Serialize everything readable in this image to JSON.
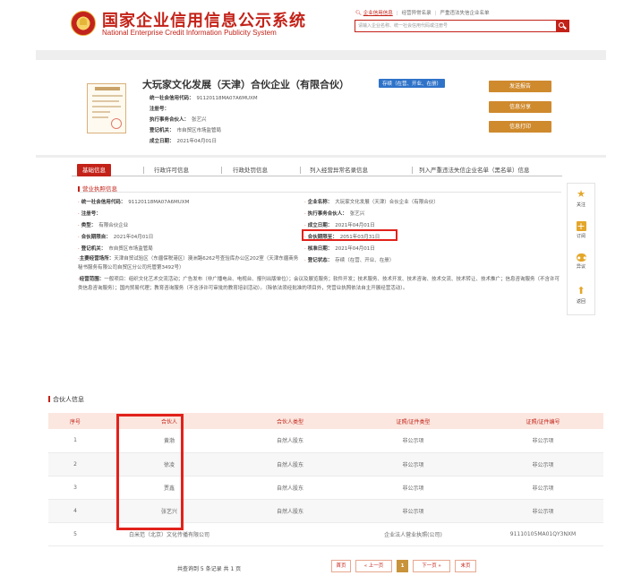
{
  "header": {
    "title": "国家企业信用信息公示系统",
    "subtitle": "National Enterprise Credit Information Publicity System",
    "search_links": [
      "企业信用信息",
      "经营异常名录",
      "严重违法失信企业名单"
    ],
    "search_placeholder": "请输入企业名称、统一社会信用代码或注册号"
  },
  "company": {
    "name": "大玩家文化发展（天津）合伙企业（有限合伙）",
    "status": "存续（在营、开业、在册）",
    "rows": [
      {
        "k": "统一社会信用代码：",
        "v": "91120118MA07A6MUXM"
      },
      {
        "k": "注册号：",
        "v": ""
      },
      {
        "k": "执行事务合伙人：",
        "v": "张艺兴"
      },
      {
        "k": "登记机关：",
        "v": "市自贸区市场监管局"
      },
      {
        "k": "成立日期：",
        "v": "2021年04月01日"
      }
    ],
    "buttons": [
      "发送报告",
      "信息分享",
      "信息打印"
    ]
  },
  "tabs": [
    "基础信息",
    "行政许可信息",
    "行政处罚信息",
    "列入经营异常名录信息",
    "列入严重违法失信企业名单（黑名单）信息"
  ],
  "license": {
    "title": "营业执照信息",
    "left": [
      {
        "k": "统一社会信用代码：",
        "v": "91120118MA07A6MUXM"
      },
      {
        "k": "注册号：",
        "v": ""
      },
      {
        "k": "类型：",
        "v": "有限合伙企业"
      },
      {
        "k": "合伙期限自：",
        "v": "2021年04月01日"
      },
      {
        "k": "登记机关：",
        "v": "市自贸区市场监管局"
      }
    ],
    "right": [
      {
        "k": "企业名称：",
        "v": "大玩家文化发展（天津）合伙企业（有限合伙）"
      },
      {
        "k": "执行事务合伙人：",
        "v": "张艺兴"
      },
      {
        "k": "成立日期：",
        "v": "2021年04月01日"
      },
      {
        "k": "合伙期限至：",
        "v": "2051年03月31日"
      },
      {
        "k": "核准日期：",
        "v": "2021年04月01日"
      }
    ],
    "address_k": "主要经营场所：",
    "address_v": "天津自贸试验区（东疆保税港区）澳洲路6262号查验库办公区202室（天津东疆商务秘书服务有限公司自贸区分公司托管第3492号）",
    "reg_status_k": "登记状态：",
    "reg_status_v": "存续（在营、开业、在册）",
    "scope_k": "经营范围：",
    "scope_v": "一般项目：组织文化艺术交流活动；广告发布（非广播电台、电视台、报刊出版单位）；会议及展览服务；软件开发；技术服务、技术开发、技术咨询、技术交流、技术转让、技术推广；信息咨询服务（不含许可类信息咨询服务）；国内贸易代理；教育咨询服务（不含涉许可审批的教育培训活动）。（除依法须经批准的项目外，凭营业执照依法自主开展经营活动）。"
  },
  "floating": [
    "关注",
    "订阅",
    "异议",
    "返回"
  ],
  "partners": {
    "title": "合伙人信息",
    "columns": [
      "序号",
      "合伙人",
      "合伙人类型",
      "证照/证件类型",
      "证照/证件编号"
    ],
    "rows": [
      [
        "1",
        "黄渤",
        "自然人股东",
        "非公示项",
        "非公示项"
      ],
      [
        "2",
        "徐凌",
        "自然人股东",
        "非公示项",
        "非公示项"
      ],
      [
        "3",
        "贾鑫",
        "自然人股东",
        "非公示项",
        "非公示项"
      ],
      [
        "4",
        "张艺兴",
        "自然人股东",
        "非公示项",
        "非公示项"
      ],
      [
        "5",
        "白米范（北京）文化传播有限公司",
        "",
        "企业法人营业执照(公司)",
        "91110105MA01QY3NXM"
      ]
    ],
    "summary": "共查询到 5 条记录 共 1 页",
    "pager": [
      "首页",
      "« 上一页",
      "1",
      "下一页 »",
      "末页"
    ]
  }
}
